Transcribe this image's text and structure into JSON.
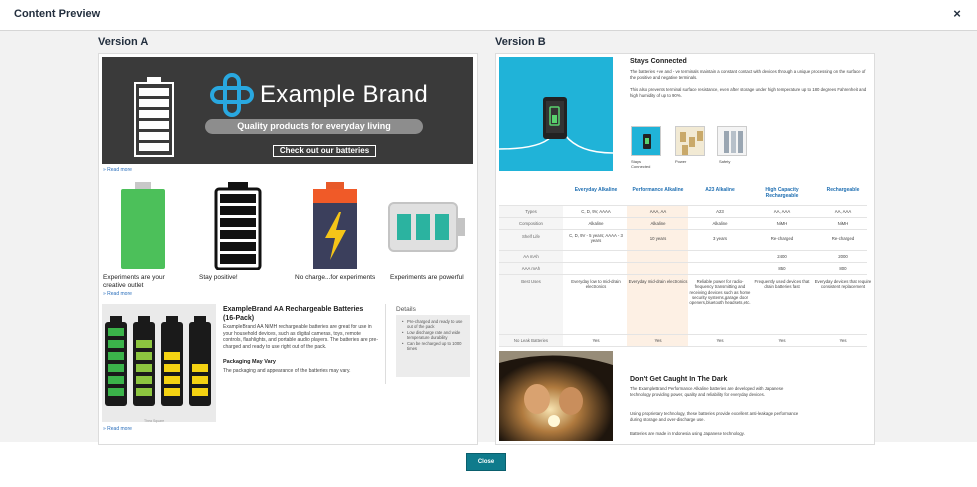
{
  "header": {
    "title": "Content Preview",
    "close_icon": "×"
  },
  "version_a": {
    "label": "Version A",
    "banner": {
      "brand": "Example Brand",
      "tagline": "Quality products for everyday living",
      "cta": "Check out our batteries"
    },
    "read_more": "» Read more",
    "features": [
      {
        "caption": "Experiments are your creative outlet"
      },
      {
        "caption": "Stay positive!"
      },
      {
        "caption": "No charge...for experiments"
      },
      {
        "caption": "Experiments are powerful"
      }
    ],
    "product": {
      "title": "ExampleBrand AA Rechargeable Batteries (16-Pack)",
      "description": "ExampleBrand AA NiMH rechargeable batteries are great for use in your household devices, such as digital cameras, toys, remote controls, flashlights, and portable audio players. The batteries are pre-charged and ready to use right out of the pack.",
      "packaging_title": "Packaging May Vary",
      "packaging_text": "The packaging and appearance of the batteries may vary.",
      "image_caption": "Thea Square"
    },
    "details": {
      "heading": "Details",
      "items": [
        "Pre-charged and ready to use out of the pack",
        "Low discharge rate and wide temperature durability",
        "Can be recharged up to 1000 times"
      ]
    }
  },
  "version_b": {
    "label": "Version B",
    "section1": {
      "title": "Stays Connected",
      "para1": "The batteries +ve and - ve terminals maintain a constant contact with devices through a unique processing on the surface of the positive and negative terminals.",
      "para2": "This also prevents terminal surface resistance, even after storage under high temperature up to 180 degrees Fahrenheit and high humidity of up to 90%.",
      "thumbs": [
        "Stays Connected",
        "Power",
        "Safety"
      ]
    },
    "table": {
      "columns": [
        "Everyday Alkaline",
        "Performance Alkaline",
        "A23 Alkaline",
        "High Capacity Rechargeable",
        "Rechargeable"
      ],
      "rows": [
        {
          "label": "Types",
          "cells": [
            "C, D, 9V, AAAA",
            "AAA, AA",
            "A23",
            "AA, AAA",
            "AA, AAA"
          ]
        },
        {
          "label": "Composition",
          "cells": [
            "Alkaline",
            "Alkaline",
            "Alkaline",
            "NiMH",
            "NiMH"
          ]
        },
        {
          "label": "Shelf Life",
          "cells": [
            "C, D, 9V - 5 years; AAAA - 3 years",
            "10 years",
            "3 years",
            "Re-charged",
            "Re-charged"
          ]
        },
        {
          "label": "AA mAh",
          "cells": [
            "",
            "",
            "",
            "2400",
            "2000"
          ]
        },
        {
          "label": "AAA mAh",
          "cells": [
            "",
            "",
            "",
            "850",
            "800"
          ]
        },
        {
          "label": "Best Uses",
          "cells": [
            "Everyday low to mid-drain electronics",
            "Everyday mid-drain electronics",
            "Reliable power for radio-frequency transmitting and receiving devices such as home security systems,garage door openers,bluetooth headsets,etc.",
            "Frequently used devices that drain batteries fast",
            "Everyday devices that require consistent replacement"
          ]
        },
        {
          "label": "No Leak Batteries",
          "cells": [
            "Yes",
            "Yes",
            "Yes",
            "Yes",
            "Yes"
          ]
        }
      ]
    },
    "section2": {
      "title": "Don't Get Caught In The Dark",
      "para1": "The ExampleBrand Performance Alkaline batteries are developed with Japanese technology providing power, quality and reliability for everyday devices.",
      "para2": "Using proprietary technology, these batteries provide excellent anti-leakage performance during storage and over-discharge use.",
      "para3": "Batteries are made in Indonesia using Japanese technology."
    }
  },
  "footer": {
    "close_label": "Close"
  },
  "colors": {
    "accent": "#0f7b8c",
    "link": "#2a6ebb",
    "highlight": "#fdf0e4",
    "hero": "#20b3d8"
  }
}
